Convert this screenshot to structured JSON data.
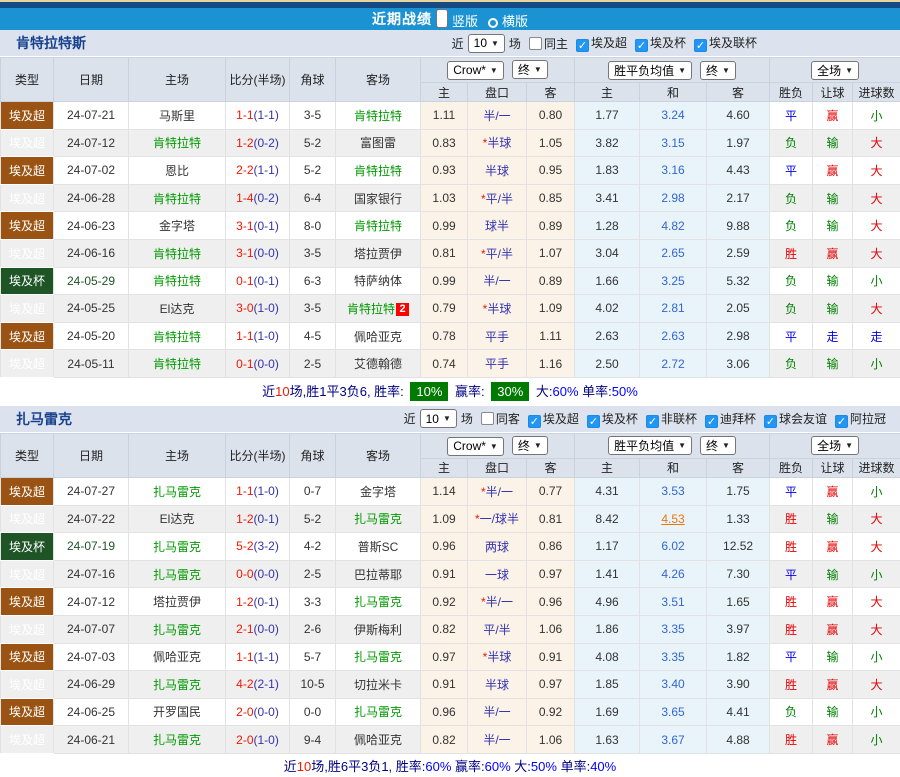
{
  "page": {
    "title": "近期战绩",
    "layout_options": [
      {
        "label": "竖版",
        "selected": true
      },
      {
        "label": "横版",
        "selected": false
      }
    ]
  },
  "ui": {
    "recent_label": "近",
    "games_label": "场"
  },
  "table_header": {
    "main_cols": [
      "类型",
      "日期",
      "主场",
      "比分(半场)",
      "角球",
      "客场"
    ],
    "odds_source_select": "Crow*",
    "odds_time_select": "终",
    "avg_source_select": "胜平负均值",
    "avg_time_select": "终",
    "scope_select": "全场",
    "odds_sub_cols": [
      "主",
      "盘口",
      "客"
    ],
    "avg_sub_cols": [
      "主",
      "和",
      "客"
    ],
    "result_cols": [
      "胜负",
      "让球",
      "进球数"
    ]
  },
  "colors": {
    "header_blue": "#1B93D3",
    "type_league_brown": "#9A5312",
    "type_cup_green": "#1E5426",
    "focus_team_green": "#009900",
    "win_red": "#E60000",
    "draw_blue": "#0000E6",
    "lose_green": "#008000",
    "highlight_orange": "#E7760E",
    "badge_green": "#007A00"
  },
  "sections": [
    {
      "team": "肯特拉特斯",
      "filters": {
        "count": "10",
        "venue_label": "同主",
        "venue_checked": false,
        "competitions": [
          {
            "label": "埃及超",
            "checked": true
          },
          {
            "label": "埃及杯",
            "checked": true
          },
          {
            "label": "埃及联杯",
            "checked": true
          }
        ]
      },
      "rows": [
        {
          "comp": "埃及超",
          "cup": false,
          "date": "24-07-21",
          "home": "马斯里",
          "home_focus": false,
          "ft": "1-1",
          "ht": "(1-1)",
          "corners": "3-5",
          "away": "肯特拉特",
          "away_focus": true,
          "away_badge": "",
          "odds_home": "1.11",
          "handicap": "半/一",
          "handicap_star": false,
          "odds_away": "0.80",
          "avg_home": "1.77",
          "avg_draw": "3.24",
          "avg_away": "4.60",
          "avg_draw_link": false,
          "result": "平",
          "handicap_result": "赢",
          "goals": "小"
        },
        {
          "comp": "埃及超",
          "cup": false,
          "date": "24-07-12",
          "home": "肯特拉特",
          "home_focus": true,
          "ft": "1-2",
          "ht": "(0-2)",
          "corners": "5-2",
          "away": "富图雷",
          "away_focus": false,
          "away_badge": "",
          "odds_home": "0.83",
          "handicap": "半球",
          "handicap_star": true,
          "odds_away": "1.05",
          "avg_home": "3.82",
          "avg_draw": "3.15",
          "avg_away": "1.97",
          "avg_draw_link": false,
          "result": "负",
          "handicap_result": "输",
          "goals": "大"
        },
        {
          "comp": "埃及超",
          "cup": false,
          "date": "24-07-02",
          "home": "恩比",
          "home_focus": false,
          "ft": "2-2",
          "ht": "(1-1)",
          "corners": "5-2",
          "away": "肯特拉特",
          "away_focus": true,
          "away_badge": "",
          "odds_home": "0.93",
          "handicap": "半球",
          "handicap_star": false,
          "odds_away": "0.95",
          "avg_home": "1.83",
          "avg_draw": "3.16",
          "avg_away": "4.43",
          "avg_draw_link": false,
          "result": "平",
          "handicap_result": "赢",
          "goals": "大"
        },
        {
          "comp": "埃及超",
          "cup": false,
          "date": "24-06-28",
          "home": "肯特拉特",
          "home_focus": true,
          "ft": "1-4",
          "ht": "(0-2)",
          "corners": "6-4",
          "away": "国家银行",
          "away_focus": false,
          "away_badge": "",
          "odds_home": "1.03",
          "handicap": "平/半",
          "handicap_star": true,
          "odds_away": "0.85",
          "avg_home": "3.41",
          "avg_draw": "2.98",
          "avg_away": "2.17",
          "avg_draw_link": false,
          "result": "负",
          "handicap_result": "输",
          "goals": "大"
        },
        {
          "comp": "埃及超",
          "cup": false,
          "date": "24-06-23",
          "home": "金字塔",
          "home_focus": false,
          "ft": "3-1",
          "ht": "(0-1)",
          "corners": "8-0",
          "away": "肯特拉特",
          "away_focus": true,
          "away_badge": "",
          "odds_home": "0.99",
          "handicap": "球半",
          "handicap_star": false,
          "odds_away": "0.89",
          "avg_home": "1.28",
          "avg_draw": "4.82",
          "avg_away": "9.88",
          "avg_draw_link": false,
          "result": "负",
          "handicap_result": "输",
          "goals": "大"
        },
        {
          "comp": "埃及超",
          "cup": false,
          "date": "24-06-16",
          "home": "肯特拉特",
          "home_focus": true,
          "ft": "3-1",
          "ht": "(0-0)",
          "corners": "3-5",
          "away": "塔拉贾伊",
          "away_focus": false,
          "away_badge": "",
          "odds_home": "0.81",
          "handicap": "平/半",
          "handicap_star": true,
          "odds_away": "1.07",
          "avg_home": "3.04",
          "avg_draw": "2.65",
          "avg_away": "2.59",
          "avg_draw_link": false,
          "result": "胜",
          "handicap_result": "赢",
          "goals": "大"
        },
        {
          "comp": "埃及杯",
          "cup": true,
          "date": "24-05-29",
          "home": "肯特拉特",
          "home_focus": true,
          "ft": "0-1",
          "ht": "(0-1)",
          "corners": "6-3",
          "away": "特萨纳体",
          "away_focus": false,
          "away_badge": "",
          "odds_home": "0.99",
          "handicap": "半/一",
          "handicap_star": false,
          "odds_away": "0.89",
          "avg_home": "1.66",
          "avg_draw": "3.25",
          "avg_away": "5.32",
          "avg_draw_link": false,
          "result": "负",
          "handicap_result": "输",
          "goals": "小"
        },
        {
          "comp": "埃及超",
          "cup": false,
          "date": "24-05-25",
          "home": "El达克",
          "home_focus": false,
          "ft": "3-0",
          "ht": "(1-0)",
          "corners": "3-5",
          "away": "肯特拉特",
          "away_focus": true,
          "away_badge": "2",
          "odds_home": "0.79",
          "handicap": "半球",
          "handicap_star": true,
          "odds_away": "1.09",
          "avg_home": "4.02",
          "avg_draw": "2.81",
          "avg_away": "2.05",
          "avg_draw_link": false,
          "result": "负",
          "handicap_result": "输",
          "goals": "大"
        },
        {
          "comp": "埃及超",
          "cup": false,
          "date": "24-05-20",
          "home": "肯特拉特",
          "home_focus": true,
          "ft": "1-1",
          "ht": "(1-0)",
          "corners": "4-5",
          "away": "佩哈亚克",
          "away_focus": false,
          "away_badge": "",
          "odds_home": "0.78",
          "handicap": "平手",
          "handicap_star": false,
          "odds_away": "1.11",
          "avg_home": "2.63",
          "avg_draw": "2.63",
          "avg_away": "2.98",
          "avg_draw_link": false,
          "result": "平",
          "handicap_result": "走",
          "goals": "走"
        },
        {
          "comp": "埃及超",
          "cup": false,
          "date": "24-05-11",
          "home": "肯特拉特",
          "home_focus": true,
          "ft": "0-1",
          "ht": "(0-0)",
          "corners": "2-5",
          "away": "艾德翰德",
          "away_focus": false,
          "away_badge": "",
          "odds_home": "0.74",
          "handicap": "平手",
          "handicap_star": false,
          "odds_away": "1.16",
          "avg_home": "2.50",
          "avg_draw": "2.72",
          "avg_away": "3.06",
          "avg_draw_link": false,
          "result": "负",
          "handicap_result": "输",
          "goals": "小"
        }
      ],
      "summary": [
        {
          "t": "近",
          "s": "navy"
        },
        {
          "t": "10",
          "s": "red"
        },
        {
          "t": "场,胜1平3负6, 胜率: ",
          "s": "navy"
        },
        {
          "t": "10%",
          "s": "badge"
        },
        {
          "t": " 赢率: ",
          "s": "navy"
        },
        {
          "t": "30%",
          "s": "badge"
        },
        {
          "t": " 大:",
          "s": "navy"
        },
        {
          "t": "60%",
          "s": "blue"
        },
        {
          "t": " 单率:",
          "s": "navy"
        },
        {
          "t": "50%",
          "s": "blue"
        }
      ]
    },
    {
      "team": "扎马雷克",
      "filters": {
        "count": "10",
        "venue_label": "同客",
        "venue_checked": false,
        "competitions": [
          {
            "label": "埃及超",
            "checked": true
          },
          {
            "label": "埃及杯",
            "checked": true
          },
          {
            "label": "非联杯",
            "checked": true
          },
          {
            "label": "迪拜杯",
            "checked": true
          },
          {
            "label": "球会友谊",
            "checked": true
          },
          {
            "label": "阿拉冠",
            "checked": true
          }
        ]
      },
      "rows": [
        {
          "comp": "埃及超",
          "cup": false,
          "date": "24-07-27",
          "home": "扎马雷克",
          "home_focus": true,
          "ft": "1-1",
          "ht": "(1-0)",
          "corners": "0-7",
          "away": "金字塔",
          "away_focus": false,
          "away_badge": "",
          "odds_home": "1.14",
          "handicap": "半/一",
          "handicap_star": true,
          "odds_away": "0.77",
          "avg_home": "4.31",
          "avg_draw": "3.53",
          "avg_away": "1.75",
          "avg_draw_link": false,
          "result": "平",
          "handicap_result": "赢",
          "goals": "小"
        },
        {
          "comp": "埃及超",
          "cup": false,
          "date": "24-07-22",
          "home": "El达克",
          "home_focus": false,
          "ft": "1-2",
          "ht": "(0-1)",
          "corners": "5-2",
          "away": "扎马雷克",
          "away_focus": true,
          "away_badge": "",
          "odds_home": "1.09",
          "handicap": "一/球半",
          "handicap_star": true,
          "odds_away": "0.81",
          "avg_home": "8.42",
          "avg_draw": "4.53",
          "avg_away": "1.33",
          "avg_draw_link": true,
          "result": "胜",
          "handicap_result": "输",
          "goals": "大"
        },
        {
          "comp": "埃及杯",
          "cup": true,
          "date": "24-07-19",
          "home": "扎马雷克",
          "home_focus": true,
          "ft": "5-2",
          "ht": "(3-2)",
          "corners": "4-2",
          "away": "普斯SC",
          "away_focus": false,
          "away_badge": "",
          "odds_home": "0.96",
          "handicap": "两球",
          "handicap_star": false,
          "odds_away": "0.86",
          "avg_home": "1.17",
          "avg_draw": "6.02",
          "avg_away": "12.52",
          "avg_draw_link": false,
          "result": "胜",
          "handicap_result": "赢",
          "goals": "大"
        },
        {
          "comp": "埃及超",
          "cup": false,
          "date": "24-07-16",
          "home": "扎马雷克",
          "home_focus": true,
          "ft": "0-0",
          "ht": "(0-0)",
          "corners": "2-5",
          "away": "巴拉蒂耶",
          "away_focus": false,
          "away_badge": "",
          "odds_home": "0.91",
          "handicap": "一球",
          "handicap_star": false,
          "odds_away": "0.97",
          "avg_home": "1.41",
          "avg_draw": "4.26",
          "avg_away": "7.30",
          "avg_draw_link": false,
          "result": "平",
          "handicap_result": "输",
          "goals": "小"
        },
        {
          "comp": "埃及超",
          "cup": false,
          "date": "24-07-12",
          "home": "塔拉贾伊",
          "home_focus": false,
          "ft": "1-2",
          "ht": "(0-1)",
          "corners": "3-3",
          "away": "扎马雷克",
          "away_focus": true,
          "away_badge": "",
          "odds_home": "0.92",
          "handicap": "半/一",
          "handicap_star": true,
          "odds_away": "0.96",
          "avg_home": "4.96",
          "avg_draw": "3.51",
          "avg_away": "1.65",
          "avg_draw_link": false,
          "result": "胜",
          "handicap_result": "赢",
          "goals": "大"
        },
        {
          "comp": "埃及超",
          "cup": false,
          "date": "24-07-07",
          "home": "扎马雷克",
          "home_focus": true,
          "ft": "2-1",
          "ht": "(0-0)",
          "corners": "2-6",
          "away": "伊斯梅利",
          "away_focus": false,
          "away_badge": "",
          "odds_home": "0.82",
          "handicap": "平/半",
          "handicap_star": false,
          "odds_away": "1.06",
          "avg_home": "1.86",
          "avg_draw": "3.35",
          "avg_away": "3.97",
          "avg_draw_link": false,
          "result": "胜",
          "handicap_result": "赢",
          "goals": "大"
        },
        {
          "comp": "埃及超",
          "cup": false,
          "date": "24-07-03",
          "home": "佩哈亚克",
          "home_focus": false,
          "ft": "1-1",
          "ht": "(1-1)",
          "corners": "5-7",
          "away": "扎马雷克",
          "away_focus": true,
          "away_badge": "",
          "odds_home": "0.97",
          "handicap": "半球",
          "handicap_star": true,
          "odds_away": "0.91",
          "avg_home": "4.08",
          "avg_draw": "3.35",
          "avg_away": "1.82",
          "avg_draw_link": false,
          "result": "平",
          "handicap_result": "输",
          "goals": "小"
        },
        {
          "comp": "埃及超",
          "cup": false,
          "date": "24-06-29",
          "home": "扎马雷克",
          "home_focus": true,
          "ft": "4-2",
          "ht": "(2-1)",
          "corners": "10-5",
          "away": "切拉米卡",
          "away_focus": false,
          "away_badge": "",
          "odds_home": "0.91",
          "handicap": "半球",
          "handicap_star": false,
          "odds_away": "0.97",
          "avg_home": "1.85",
          "avg_draw": "3.40",
          "avg_away": "3.90",
          "avg_draw_link": false,
          "result": "胜",
          "handicap_result": "赢",
          "goals": "大"
        },
        {
          "comp": "埃及超",
          "cup": false,
          "date": "24-06-25",
          "home": "开罗国民",
          "home_focus": false,
          "ft": "2-0",
          "ht": "(0-0)",
          "corners": "0-0",
          "away": "扎马雷克",
          "away_focus": true,
          "away_badge": "",
          "odds_home": "0.96",
          "handicap": "半/一",
          "handicap_star": false,
          "odds_away": "0.92",
          "avg_home": "1.69",
          "avg_draw": "3.65",
          "avg_away": "4.41",
          "avg_draw_link": false,
          "result": "负",
          "handicap_result": "输",
          "goals": "小"
        },
        {
          "comp": "埃及超",
          "cup": false,
          "date": "24-06-21",
          "home": "扎马雷克",
          "home_focus": true,
          "ft": "2-0",
          "ht": "(1-0)",
          "corners": "9-4",
          "away": "佩哈亚克",
          "away_focus": false,
          "away_badge": "",
          "odds_home": "0.82",
          "handicap": "半/一",
          "handicap_star": false,
          "odds_away": "1.06",
          "avg_home": "1.63",
          "avg_draw": "3.67",
          "avg_away": "4.88",
          "avg_draw_link": false,
          "result": "胜",
          "handicap_result": "赢",
          "goals": "小"
        }
      ],
      "summary": [
        {
          "t": "近",
          "s": "navy"
        },
        {
          "t": "10",
          "s": "red"
        },
        {
          "t": "场,胜6平3负1, 胜率:",
          "s": "navy"
        },
        {
          "t": "60%",
          "s": "blue"
        },
        {
          "t": " 赢率:",
          "s": "navy"
        },
        {
          "t": "60%",
          "s": "blue"
        },
        {
          "t": " 大:",
          "s": "navy"
        },
        {
          "t": "50%",
          "s": "blue"
        },
        {
          "t": " 单率:",
          "s": "navy"
        },
        {
          "t": "40%",
          "s": "blue"
        }
      ]
    }
  ]
}
